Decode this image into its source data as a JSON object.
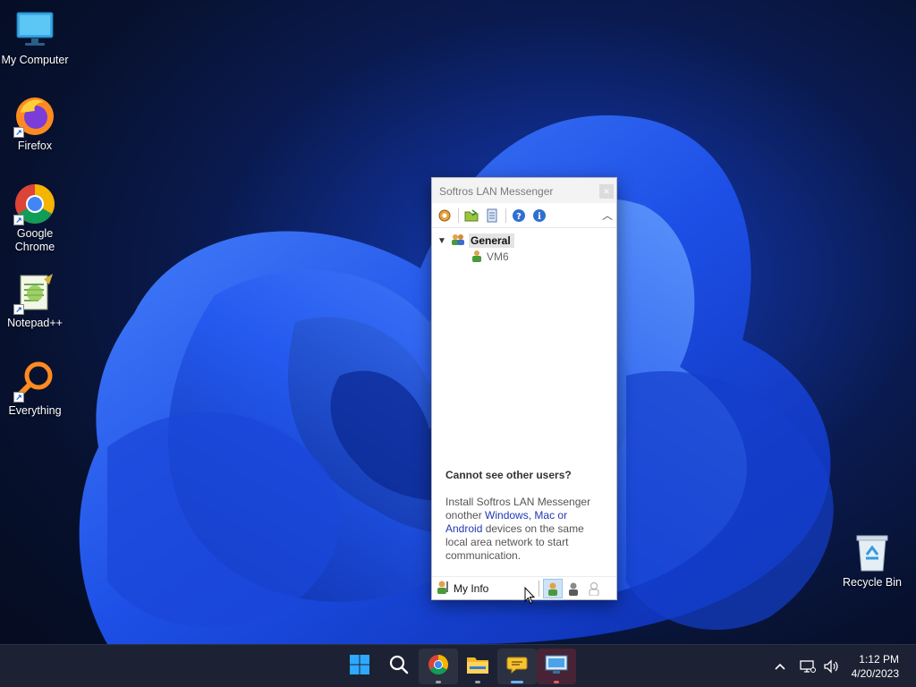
{
  "desktop": {
    "icons": [
      {
        "label": "My Computer",
        "icon": "monitor-icon"
      },
      {
        "label": "Firefox",
        "icon": "firefox-icon"
      },
      {
        "label": "Google Chrome",
        "icon": "chrome-icon"
      },
      {
        "label": "Notepad++",
        "icon": "notepadpp-icon"
      },
      {
        "label": "Everything",
        "icon": "everything-search-icon"
      }
    ],
    "recycle_bin": {
      "label": "Recycle Bin",
      "icon": "recycle-bin-icon"
    }
  },
  "messenger": {
    "title": "Softros LAN Messenger",
    "toolbar": [
      "settings-icon",
      "open-folder-icon",
      "history-icon",
      "help-icon",
      "about-icon"
    ],
    "tree": {
      "group": "General",
      "users": [
        "VM6"
      ]
    },
    "info": {
      "heading": "Cannot see other users?",
      "text_before": "Install Softros LAN Messenger onother ",
      "link": "Windows, Mac or Android",
      "text_after": " devices on the same local area network to start communication."
    },
    "footer": {
      "my_info": "My Info",
      "statuses": [
        "online",
        "away",
        "offline"
      ]
    }
  },
  "taskbar": {
    "apps": [
      "start",
      "search",
      "chrome",
      "file-explorer",
      "softros-messenger",
      "remote-desktop"
    ],
    "clock": {
      "time": "1:12 PM",
      "date": "4/20/2023"
    }
  },
  "colors": {
    "accent": "#2138b6",
    "taskbar": "#1c2233",
    "active_indicator": "#6cb2ff"
  }
}
